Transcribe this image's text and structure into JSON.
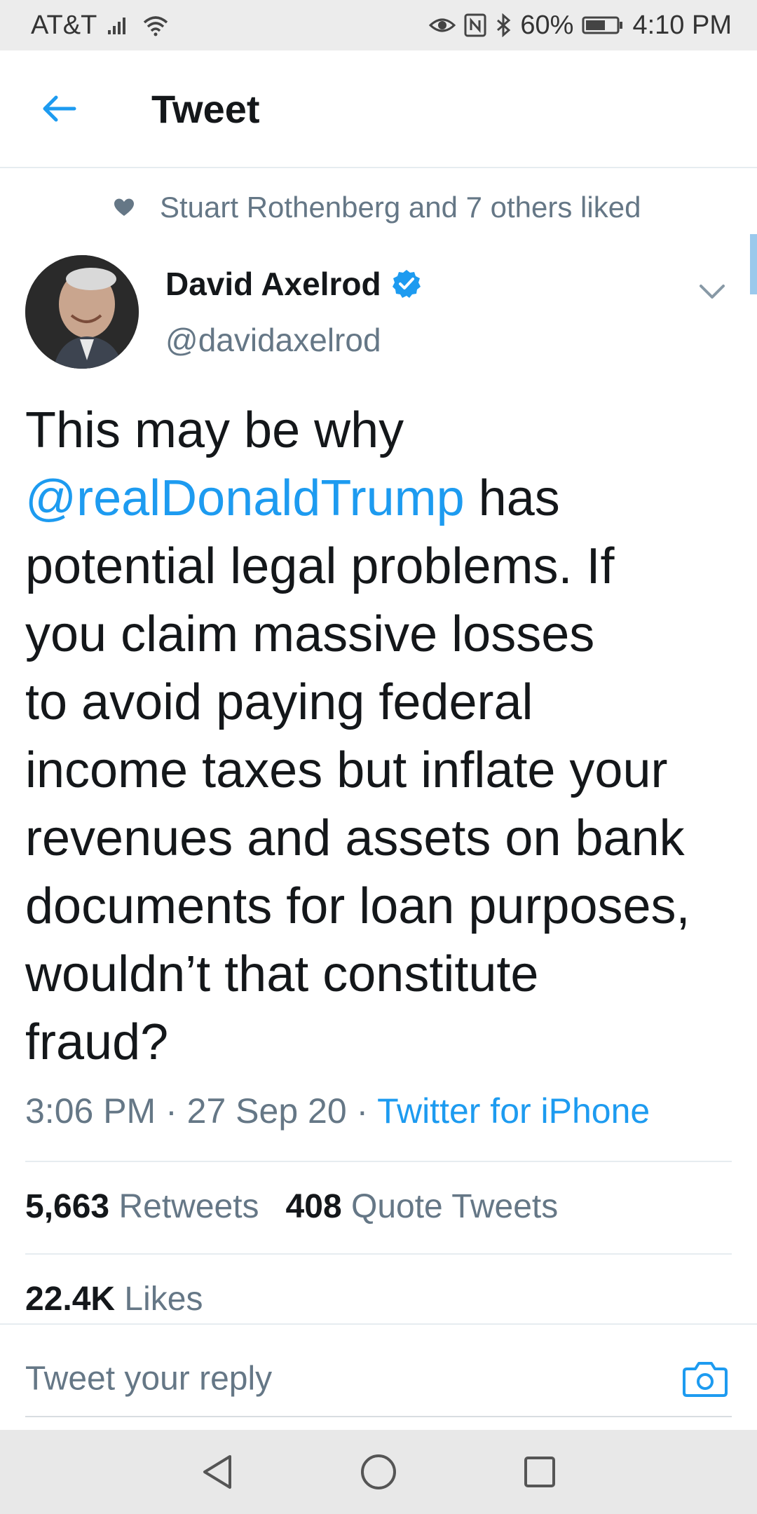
{
  "status_bar": {
    "carrier": "AT&T",
    "battery_percent": "60%",
    "time": "4:10 PM",
    "icons": [
      "signal-icon",
      "wifi-icon",
      "eye-icon",
      "nfc-icon",
      "bluetooth-icon",
      "battery-icon"
    ]
  },
  "header": {
    "title": "Tweet",
    "back_icon": "arrow-left-icon"
  },
  "social_context": {
    "text": "Stuart Rothenberg and 7 others liked",
    "icon": "heart-icon"
  },
  "author": {
    "name": "David Axelrod",
    "handle": "@davidaxelrod",
    "verified": true
  },
  "tweet": {
    "line1": "This may be why",
    "mention": "@realDonaldTrump",
    "line2_rest": " has",
    "line3": "potential legal problems.  If",
    "line4": "you claim massive losses",
    "line5": "to avoid paying federal",
    "line6": "income taxes but inflate your",
    "line7": "revenues and assets on bank",
    "line8": "documents for loan purposes,",
    "line9": "wouldn’t that constitute",
    "line10": "fraud?"
  },
  "meta": {
    "time": "3:06 PM",
    "sep1": " · ",
    "date": "27 Sep 20",
    "sep2": " · ",
    "source": "Twitter for iPhone"
  },
  "stats": {
    "retweets_count": "5,663",
    "retweets_label": " Retweets",
    "quotes_count": "408",
    "quotes_label": " Quote Tweets",
    "likes_count": "22.4K",
    "likes_label": " Likes"
  },
  "reply": {
    "placeholder": "Tweet your reply",
    "camera_icon": "camera-icon"
  },
  "colors": {
    "accent": "#1d9bf0",
    "secondary_text": "#657786",
    "primary_text": "#14171a",
    "status_bar_bg": "#ececec",
    "nav_bar_bg": "#e8e8e8"
  }
}
